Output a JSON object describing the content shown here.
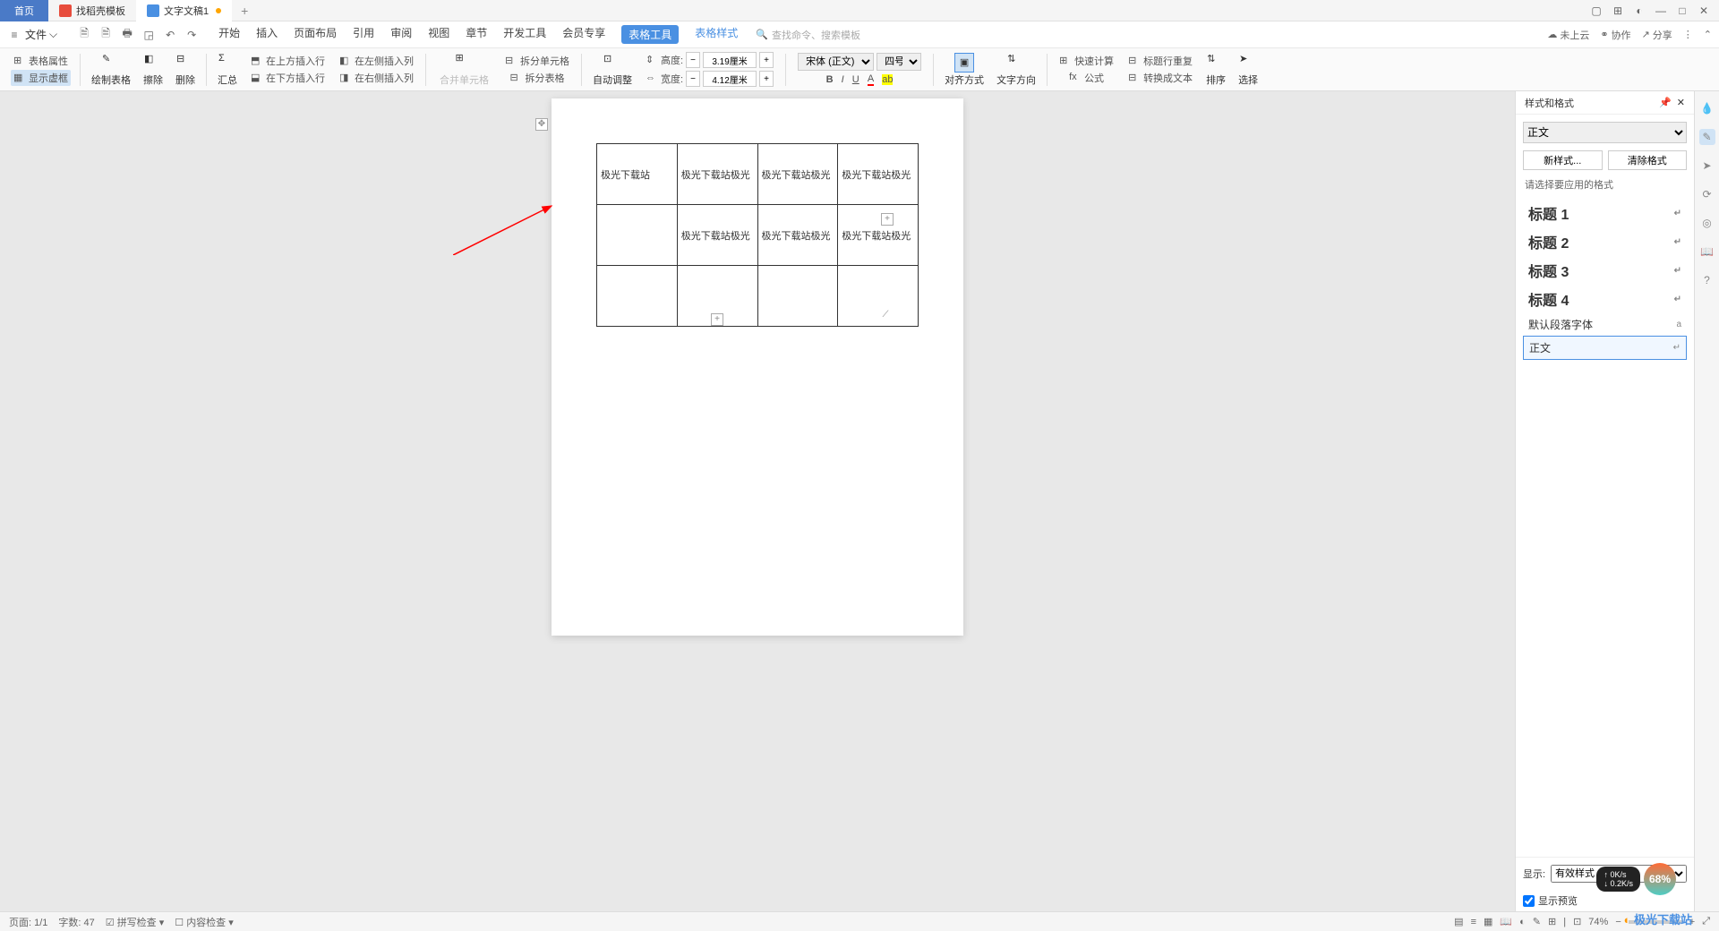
{
  "tabs": {
    "home": "首页",
    "template": "找稻壳模板",
    "doc": "文字文稿1"
  },
  "menu": {
    "file": "文件",
    "tabs": [
      "开始",
      "插入",
      "页面布局",
      "引用",
      "审阅",
      "视图",
      "章节",
      "开发工具",
      "会员专享",
      "表格工具",
      "表格样式"
    ],
    "search": "查找命令、搜索模板",
    "cloud": "未上云",
    "collab": "协作",
    "share": "分享"
  },
  "ribbon": {
    "table_props": "表格属性",
    "show_border": "显示虚框",
    "draw_table": "绘制表格",
    "eraser": "擦除",
    "delete": "删除",
    "summary": "汇总",
    "insert_above": "在上方插入行",
    "insert_below": "在下方插入行",
    "insert_left": "在左侧插入列",
    "insert_right": "在右侧插入列",
    "merge": "合并单元格",
    "split_cell": "拆分单元格",
    "split_table": "拆分表格",
    "auto_adjust": "自动调整",
    "height_label": "高度:",
    "height_val": "3.19厘米",
    "width_label": "宽度:",
    "width_val": "4.12厘米",
    "font": "宋体 (正文)",
    "font_size": "四号",
    "align": "对齐方式",
    "text_dir": "文字方向",
    "quick_calc": "快速计算",
    "formula": "公式",
    "header_repeat": "标题行重复",
    "to_text": "转换成文本",
    "sort": "排序",
    "select": "选择"
  },
  "table": {
    "r1": [
      "极光下载站",
      "极光下载站极光",
      "极光下载站极光",
      "极光下载站极光"
    ],
    "r2": [
      "",
      "极光下载站极光",
      "极光下载站极光",
      "极光下载站极光"
    ],
    "r3": [
      "",
      "",
      "",
      ""
    ]
  },
  "panel": {
    "title": "样式和格式",
    "current": "正文",
    "new_style": "新样式...",
    "clear": "清除格式",
    "choose": "请选择要应用的格式",
    "styles": [
      "标题 1",
      "标题 2",
      "标题 3",
      "标题 4"
    ],
    "default_font": "默认段落字体",
    "body": "正文",
    "show_label": "显示:",
    "show_val": "有效样式",
    "preview": "显示预览"
  },
  "status": {
    "page": "页面: 1/1",
    "words": "字数: 47",
    "spell": "拼写检查",
    "content": "内容检查",
    "zoom": "74%"
  },
  "float": {
    "speed_up": "0K/s",
    "speed_dn": "0.2K/s",
    "percent": "68%"
  },
  "watermark": "极光下载站"
}
